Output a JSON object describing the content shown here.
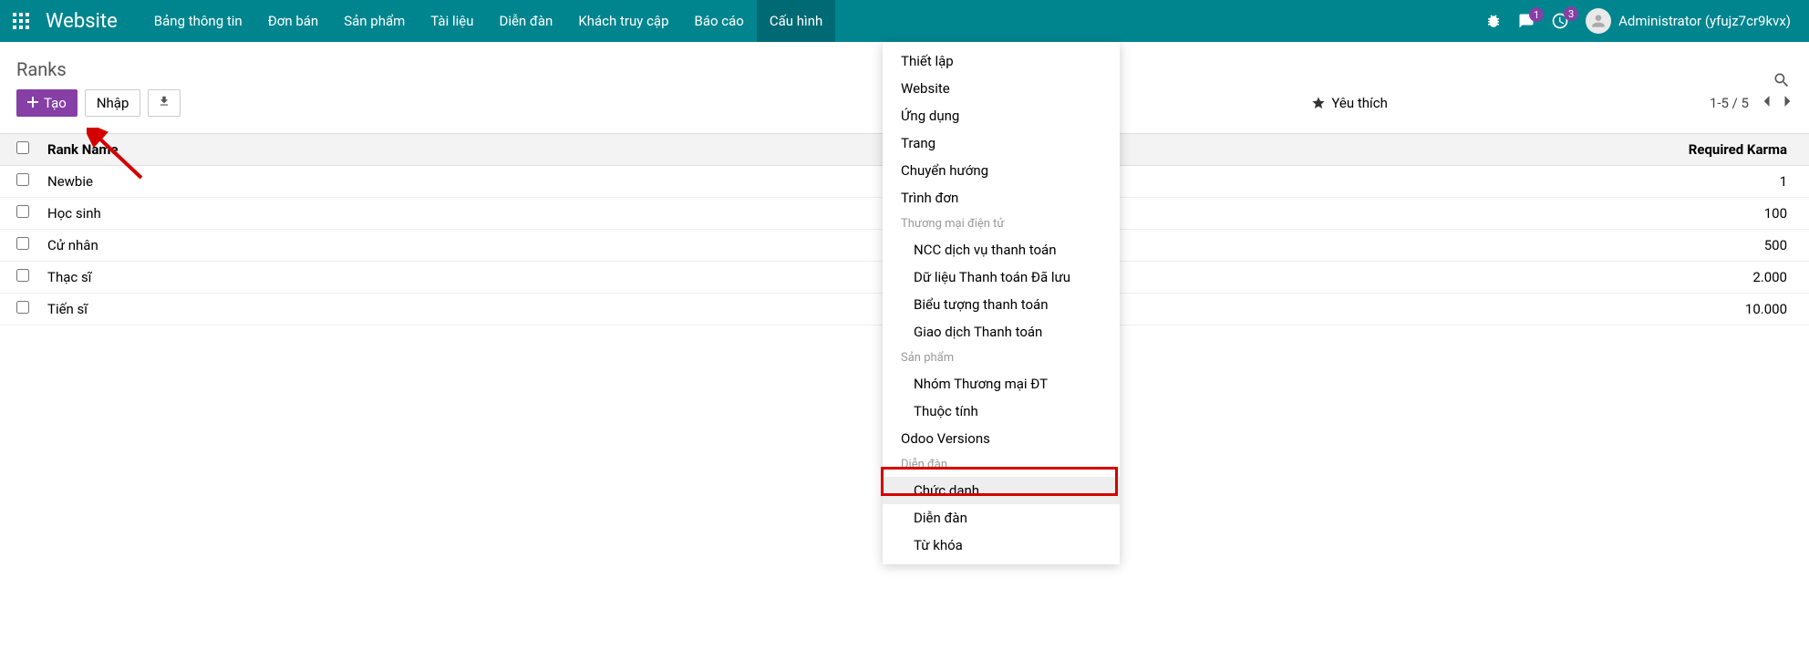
{
  "topnav": {
    "app_title": "Website",
    "menus": [
      "Bảng thông tin",
      "Đơn bán",
      "Sản phẩm",
      "Tài liệu",
      "Diễn đàn",
      "Khách truy cập",
      "Báo cáo",
      "Cấu hình"
    ],
    "active_index": 7,
    "chat_badge": "1",
    "clock_badge": "3",
    "user_name": "Administrator (yfujz7cr9kvx)"
  },
  "page": {
    "title": "Ranks",
    "btn_create": "Tạo",
    "btn_import": "Nhập",
    "fav_label": "Yêu thích",
    "pager_text": "1-5 / 5"
  },
  "search_placeholder": "",
  "table": {
    "col1": "Rank Name",
    "col2": "Required Karma",
    "rows": [
      {
        "name": "Newbie",
        "karma": "1"
      },
      {
        "name": "Học sinh",
        "karma": "100"
      },
      {
        "name": "Cử nhân",
        "karma": "500"
      },
      {
        "name": "Thạc sĩ",
        "karma": "2.000"
      },
      {
        "name": "Tiến sĩ",
        "karma": "10.000"
      }
    ]
  },
  "dropdown": {
    "items": [
      {
        "label": "Thiết lập",
        "type": "item"
      },
      {
        "label": "Website",
        "type": "item"
      },
      {
        "label": "Ứng dụng",
        "type": "item"
      },
      {
        "label": "Trang",
        "type": "item"
      },
      {
        "label": "Chuyển hướng",
        "type": "item"
      },
      {
        "label": "Trình đơn",
        "type": "item"
      },
      {
        "label": "Thương mại điện tử",
        "type": "header"
      },
      {
        "label": "NCC dịch vụ thanh toán",
        "type": "sub"
      },
      {
        "label": "Dữ liệu Thanh toán Đã lưu",
        "type": "sub"
      },
      {
        "label": "Biểu tượng thanh toán",
        "type": "sub"
      },
      {
        "label": "Giao dịch Thanh toán",
        "type": "sub"
      },
      {
        "label": "Sản phẩm",
        "type": "header"
      },
      {
        "label": "Nhóm Thương mại ĐT",
        "type": "sub"
      },
      {
        "label": "Thuộc tính",
        "type": "sub"
      },
      {
        "label": "Odoo Versions",
        "type": "item"
      },
      {
        "label": "Diễn đàn",
        "type": "header"
      },
      {
        "label": "Chức danh",
        "type": "sub",
        "hl": true
      },
      {
        "label": "Diễn đàn",
        "type": "sub"
      },
      {
        "label": "Từ khóa",
        "type": "sub"
      }
    ]
  }
}
